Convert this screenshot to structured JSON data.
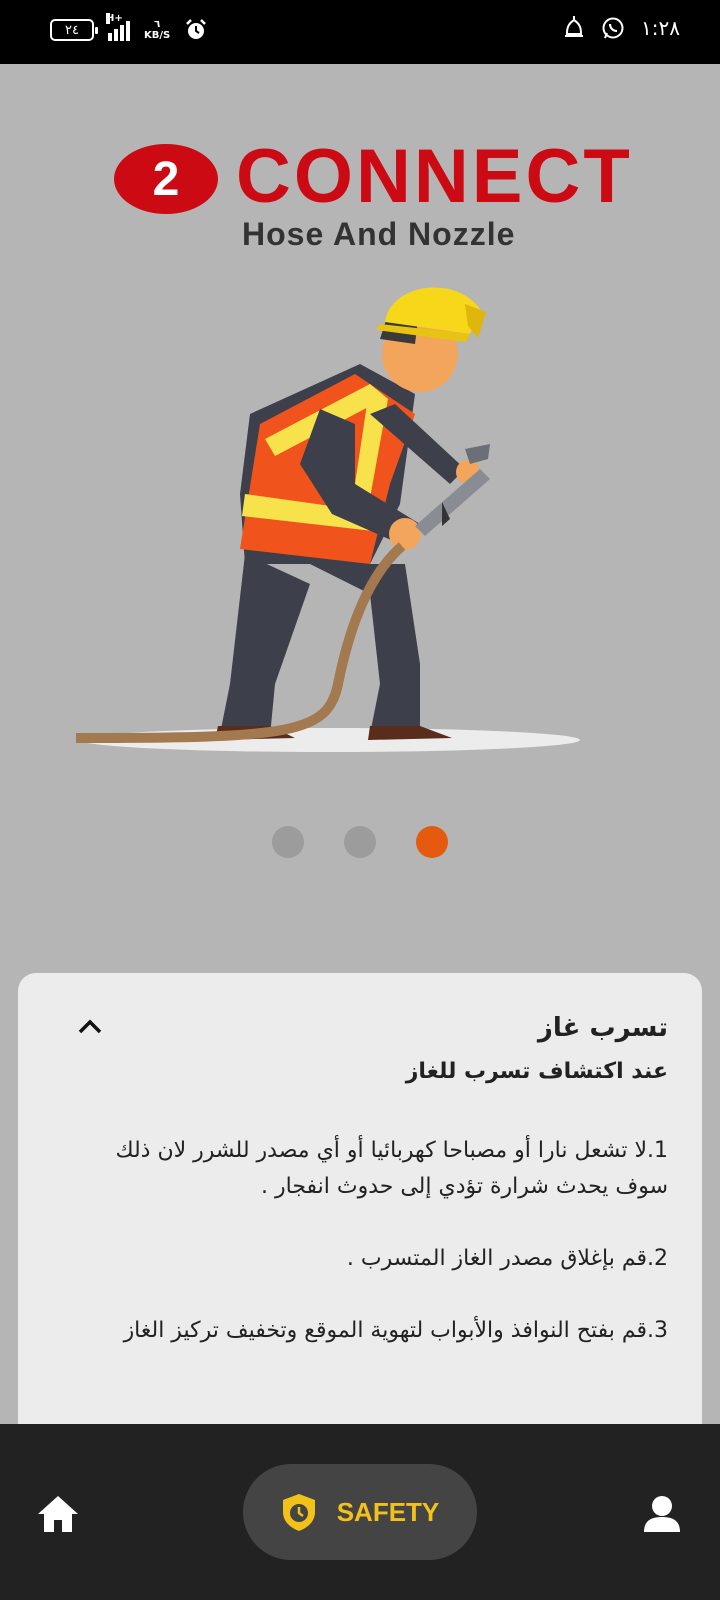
{
  "status_bar": {
    "battery": "٢٤",
    "network_tag": "H+",
    "speed_value": "٦",
    "speed_unit": "KB/S",
    "time": "١:٢٨"
  },
  "hero": {
    "step_number": "2",
    "step_word": "CONNECT",
    "step_subtitle": "Hose And Nozzle",
    "illustration": "worker-holding-hose-nozzle",
    "pager": {
      "count": 3,
      "active_index": 2
    },
    "colors": {
      "brand_red": "#cc0a14",
      "dot_active": "#e55a0e",
      "dot_inactive": "#9c9c9c"
    }
  },
  "card": {
    "title": "تسرب غاز",
    "subtitle": "عند اكتشاف تسرب للغاز",
    "steps": [
      "1.لا تشعل نارا أو مصباحا كهربائيا أو أي مصدر للشرر لان ذلك سوف يحدث شرارة تؤدي إلى حدوث انفجار .",
      "2.قم بإغلاق مصدر الغاز المتسرب .",
      "3.قم بفتح النوافذ والأبواب لتهوية الموقع وتخفيف تركيز الغاز"
    ],
    "collapse_icon": "chevron-up-icon"
  },
  "bottom_nav": {
    "home_icon": "home-icon",
    "active_label": "SAFETY",
    "active_icon": "shield-clock-icon",
    "profile_icon": "user-icon",
    "accent": "#f3c21a"
  }
}
